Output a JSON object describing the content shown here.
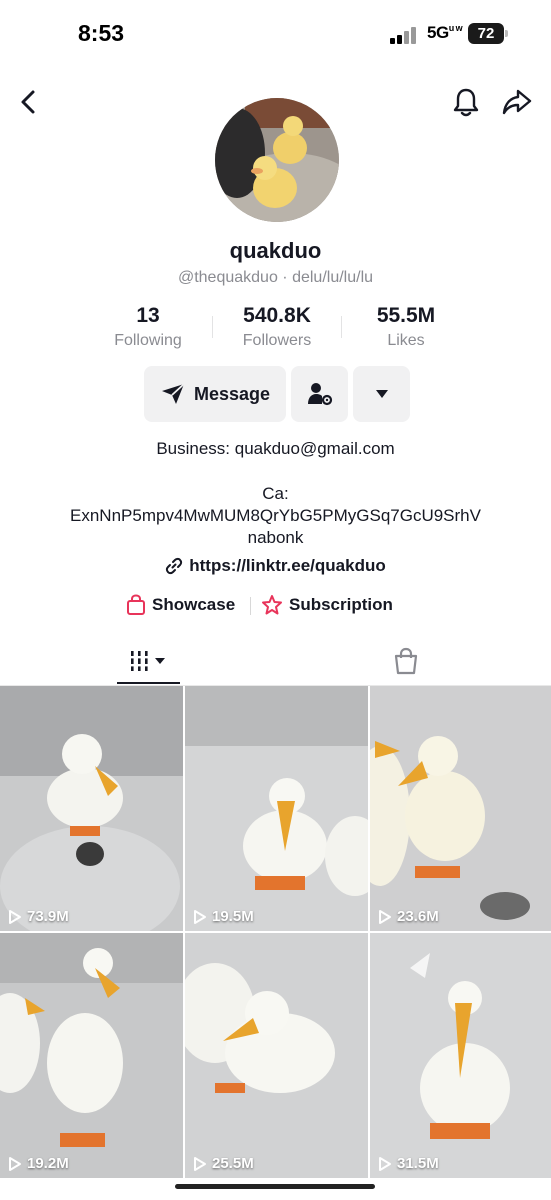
{
  "status_bar": {
    "time": "8:53",
    "network": "5G",
    "battery": "72"
  },
  "nav": {
    "back_icon": "chevron-left-icon",
    "bell_icon": "bell-icon",
    "share_icon": "share-arrow-icon"
  },
  "profile": {
    "display_name": "quakduo",
    "handle": "@thequakduo",
    "separator": "·",
    "pronouns": "delu/lu/lu/lu"
  },
  "stats": [
    {
      "value": "13",
      "label": "Following"
    },
    {
      "value": "540.8K",
      "label": "Followers"
    },
    {
      "value": "55.5M",
      "label": "Likes"
    }
  ],
  "actions": {
    "message_label": "Message",
    "message_icon": "send-icon",
    "add_friend_icon": "user-gear-icon",
    "more_icon": "caret-down-icon"
  },
  "bio": {
    "business": "Business: quakduo@gmail.com",
    "ca_label": "Ca:",
    "ca_line1": "ExnNnP5mpv4MwMUM8QrYbG5PMyGSq7GcU9SrhV",
    "ca_line2": "nabonk",
    "link": "https://linktr.ee/quakduo"
  },
  "features": {
    "showcase": "Showcase",
    "subscription": "Subscription",
    "accent_color": "#e8345a"
  },
  "tabs": {
    "videos_icon": "grid-bars-icon",
    "shop_icon": "shopping-bag-icon"
  },
  "videos": [
    {
      "views": "73.9M"
    },
    {
      "views": "19.5M"
    },
    {
      "views": "23.6M"
    },
    {
      "views": "19.2M"
    },
    {
      "views": "25.5M"
    },
    {
      "views": "31.5M"
    }
  ]
}
